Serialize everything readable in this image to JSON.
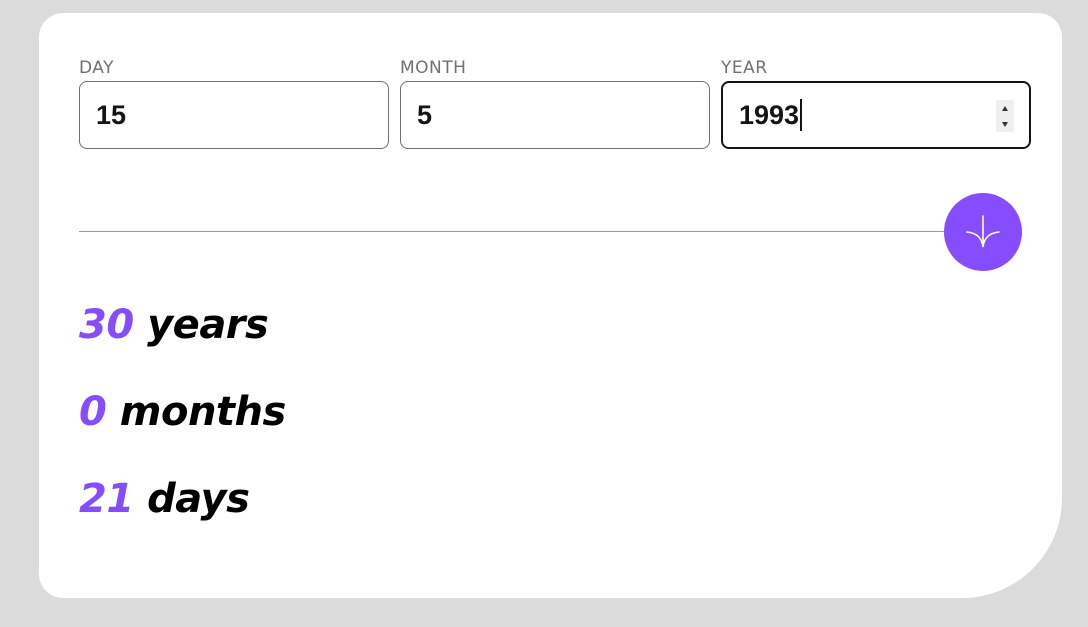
{
  "form": {
    "day": {
      "label": "DAY",
      "value": "15"
    },
    "month": {
      "label": "MONTH",
      "value": "5"
    },
    "year": {
      "label": "YEAR",
      "value": "1993"
    }
  },
  "submit_icon": "arrow-down-icon",
  "results": {
    "years": {
      "value": "30",
      "unit": "years"
    },
    "months": {
      "value": "0",
      "unit": "months"
    },
    "days": {
      "value": "21",
      "unit": "days"
    }
  },
  "colors": {
    "accent": "#854dff",
    "background": "#dbdbdb",
    "card": "#ffffff",
    "label": "#716f6f",
    "text": "#141414"
  }
}
